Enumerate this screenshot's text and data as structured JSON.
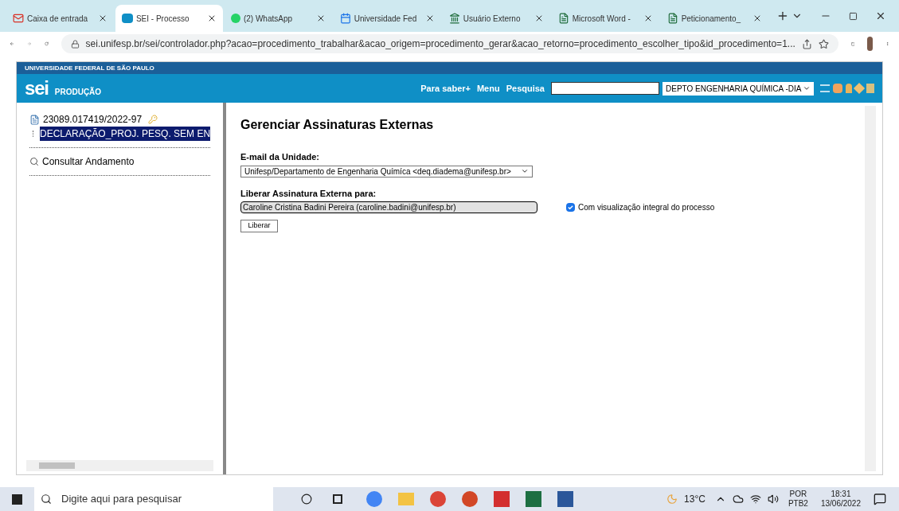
{
  "browser": {
    "tabs": [
      {
        "title": "Caixa de entrada",
        "selected": false,
        "kind": "mail"
      },
      {
        "title": "SEI - Processo",
        "selected": true,
        "kind": "sei"
      },
      {
        "title": "(2) WhatsApp",
        "selected": false,
        "kind": "chat"
      },
      {
        "title": "Universidade Fed",
        "selected": false,
        "kind": "calendar"
      },
      {
        "title": "Usuário Externo",
        "selected": false,
        "kind": "bank"
      },
      {
        "title": "Microsoft Word -",
        "selected": false,
        "kind": "doc"
      },
      {
        "title": "Peticionamento_",
        "selected": false,
        "kind": "doc"
      }
    ],
    "url": "sei.unifesp.br/sei/controlador.php?acao=procedimento_trabalhar&acao_origem=procedimento_gerar&acao_retorno=procedimento_escolher_tipo&id_procedimento=1..."
  },
  "header": {
    "org": "UNIVERSIDADE FEDERAL DE SÃO PAULO",
    "logo": "sei",
    "environment": "PRODUÇÃO",
    "links": [
      "Para saber+",
      "Menu",
      "Pesquisa"
    ],
    "unit": "DEPTO ENGENHARIA QUÍMICA -DIA"
  },
  "tree": {
    "process": "23089.017419/2022-97",
    "children": [
      {
        "label": "DECLARAÇÃO_PROJ. PESQ. SEM EN",
        "selected": true
      }
    ],
    "action": "Consultar Andamento"
  },
  "form": {
    "title": "Gerenciar Assinaturas Externas",
    "email_label": "E-mail da Unidade:",
    "email_value": "Unifesp/Departamento de Engenharia Químíca <deq.diadema@unifesp.br>",
    "liberar_label": "Liberar Assinatura Externa para:",
    "liberar_value": "Caroline Cristina Badini Pereira (caroline.badini@unifesp.br)",
    "checkbox": {
      "label": "Com visualização integral do processo",
      "checked": true
    },
    "button": "Liberar"
  },
  "taskbar": {
    "search_placeholder": "Digite aqui para pesquisar",
    "temperature": "13°C",
    "language": "POR",
    "layout": "PTB2",
    "time": "18:31",
    "date": "13/06/2022"
  }
}
